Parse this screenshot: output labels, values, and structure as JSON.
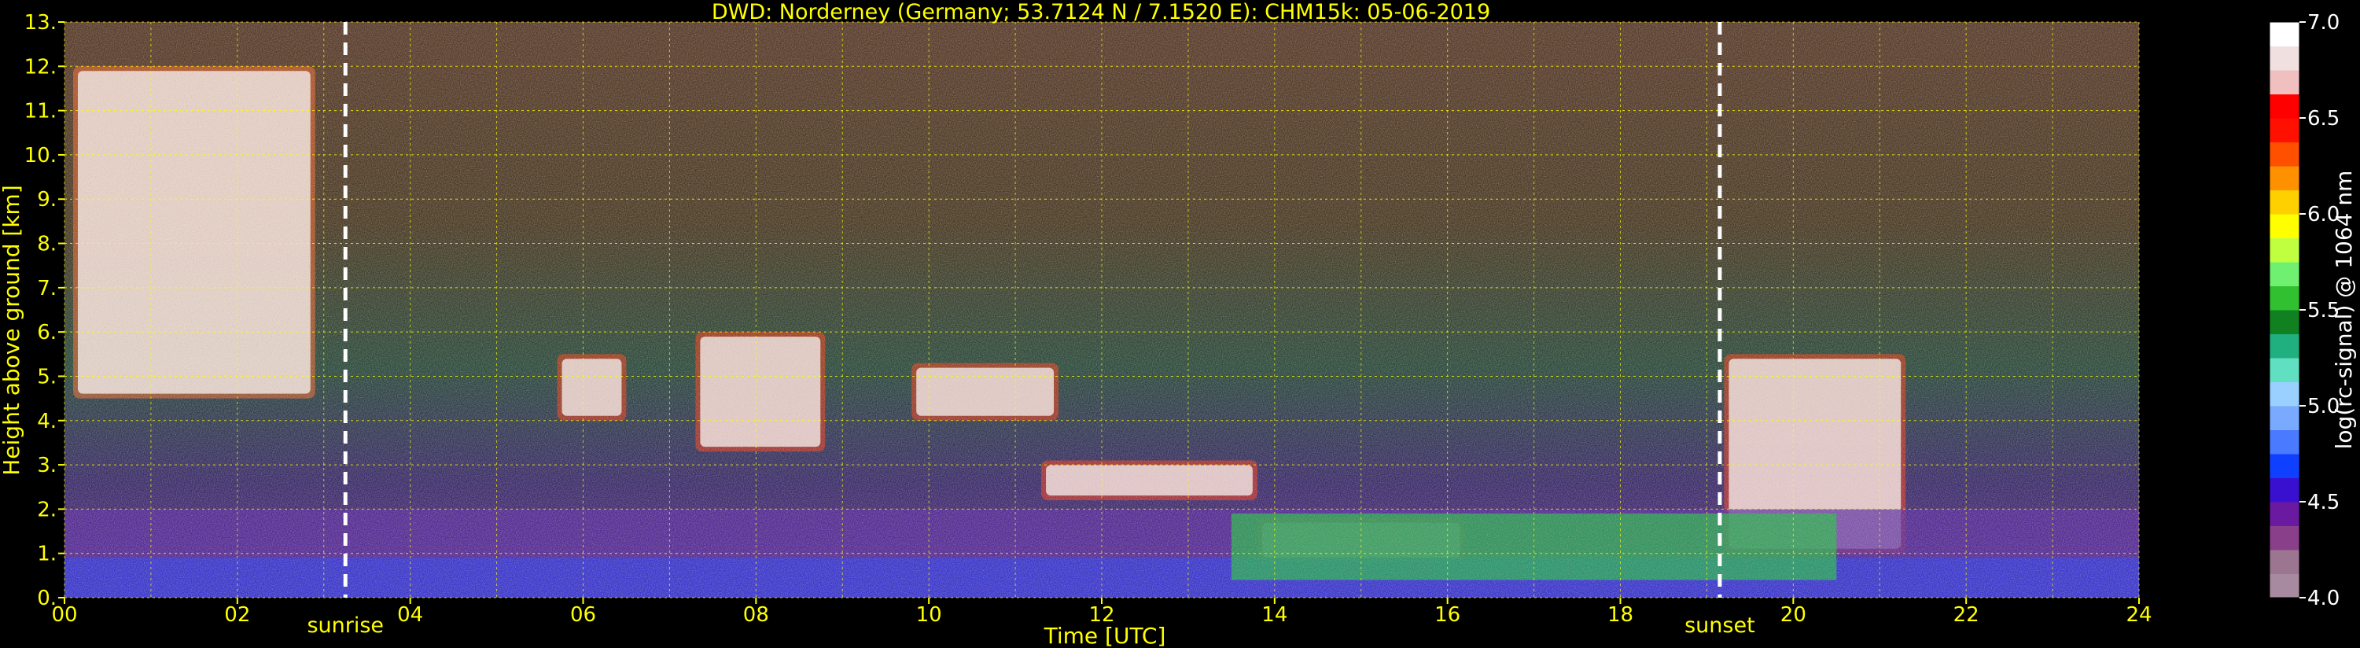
{
  "chart_data": {
    "type": "heatmap",
    "title": "DWD: Norderney (Germany; 53.7124 N / 7.1520 E):    CHM15k: 05-06-2019",
    "xlabel": "Time [UTC]",
    "ylabel": "Height above ground [km]",
    "xlim": [
      0,
      24
    ],
    "ylim": [
      0,
      13
    ],
    "x_ticks": [
      "00",
      "02",
      "04",
      "06",
      "08",
      "10",
      "12",
      "14",
      "16",
      "18",
      "20",
      "22",
      "24"
    ],
    "y_ticks": [
      "0.",
      "1.",
      "2.",
      "3.",
      "4.",
      "5.",
      "6.",
      "7.",
      "8.",
      "9.",
      "10.",
      "11.",
      "12.",
      "13."
    ],
    "grid": true,
    "events": [
      {
        "label": "sunrise",
        "time": 3.25
      },
      {
        "label": "sunset",
        "time": 19.15
      }
    ],
    "colorbar": {
      "label": "log(rc-signal) @ 1064 nm",
      "range": [
        4.0,
        7.0
      ],
      "ticks": [
        "4.0",
        "4.5",
        "5.0",
        "5.5",
        "6.0",
        "6.5",
        "7.0"
      ],
      "colors": [
        "#a88aa0",
        "#9c7590",
        "#8a3f8a",
        "#6a1aa0",
        "#3a10d0",
        "#1040ff",
        "#4a7aff",
        "#7aaaff",
        "#9ad0ff",
        "#60e0c0",
        "#20b080",
        "#108020",
        "#30c030",
        "#70f070",
        "#c0ff40",
        "#ffff00",
        "#ffd000",
        "#ff9000",
        "#ff5000",
        "#ff1000",
        "#ff0000",
        "#f0c0c0",
        "#f0e0e0",
        "#ffffff"
      ]
    },
    "features": [
      {
        "type": "high cloud",
        "t_start": 0.1,
        "t_end": 2.9,
        "h_start": 4.5,
        "h_end": 12.0
      },
      {
        "type": "cloud",
        "t_start": 5.7,
        "t_end": 6.5,
        "h_start": 4.0,
        "h_end": 5.5
      },
      {
        "type": "cloud",
        "t_start": 7.3,
        "t_end": 8.8,
        "h_start": 3.3,
        "h_end": 6.0
      },
      {
        "type": "cloud",
        "t_start": 9.8,
        "t_end": 11.5,
        "h_start": 4.0,
        "h_end": 5.3
      },
      {
        "type": "cloud",
        "t_start": 11.3,
        "t_end": 13.8,
        "h_start": 2.2,
        "h_end": 3.1
      },
      {
        "type": "cloud",
        "t_start": 13.8,
        "t_end": 16.2,
        "h_start": 0.8,
        "h_end": 1.8
      },
      {
        "type": "cloud",
        "t_start": 19.2,
        "t_end": 21.3,
        "h_start": 1.0,
        "h_end": 5.5
      },
      {
        "type": "boundary layer",
        "t_start": 0.0,
        "t_end": 24.0,
        "h_start": 0.0,
        "h_end": 2.0
      }
    ]
  }
}
